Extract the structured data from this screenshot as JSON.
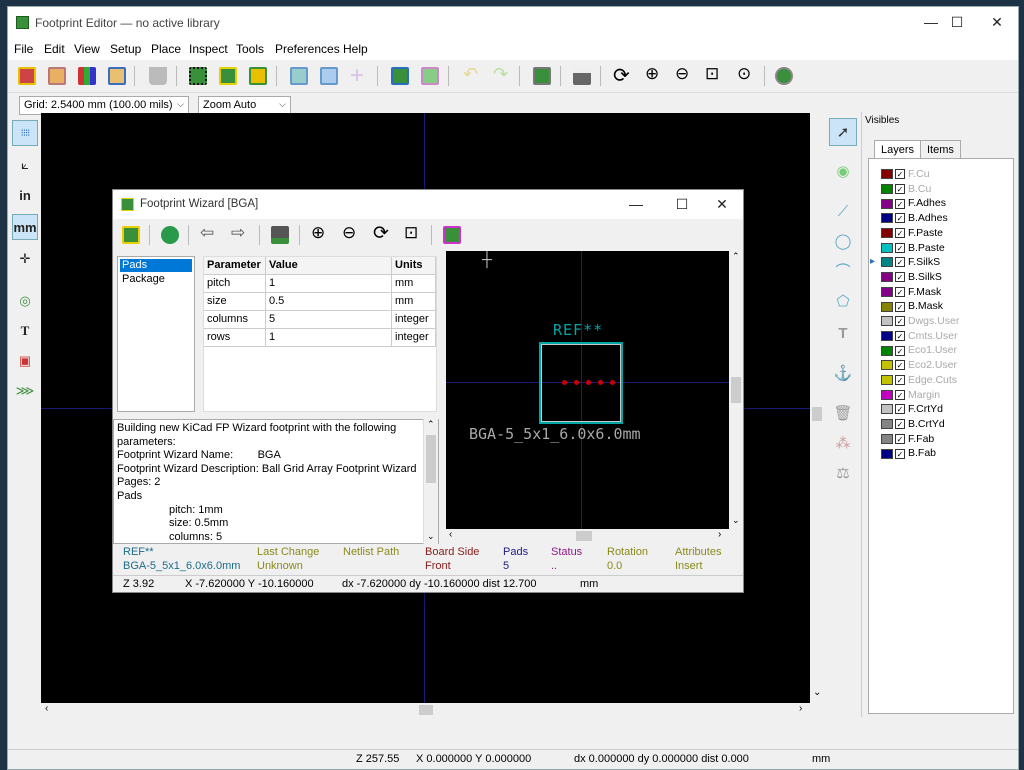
{
  "window": {
    "title": "Footprint Editor — no active library",
    "minimize": "—",
    "maximize": "☐",
    "close": "✕"
  },
  "menu": [
    "File",
    "Edit",
    "View",
    "Setup",
    "Place",
    "Inspect",
    "Tools",
    "Preferences",
    "Help"
  ],
  "options": {
    "grid": "Grid: 2.5400 mm (100.00 mils)",
    "zoom": "Zoom Auto"
  },
  "left_toolbar": {
    "units_in": "in",
    "units_mm": "mm"
  },
  "panel": {
    "title": "Visibles",
    "tabs": [
      "Layers",
      "Items"
    ],
    "layers": [
      {
        "name": "F.Cu",
        "color": "#840000",
        "dim": true
      },
      {
        "name": "B.Cu",
        "color": "#008400",
        "dim": true
      },
      {
        "name": "F.Adhes",
        "color": "#840084",
        "dim": false
      },
      {
        "name": "B.Adhes",
        "color": "#000084",
        "dim": false
      },
      {
        "name": "F.Paste",
        "color": "#840000",
        "dim": false
      },
      {
        "name": "B.Paste",
        "color": "#00c2c2",
        "dim": false
      },
      {
        "name": "F.SilkS",
        "color": "#008484",
        "dim": false
      },
      {
        "name": "B.SilkS",
        "color": "#840084",
        "dim": false
      },
      {
        "name": "F.Mask",
        "color": "#840084",
        "dim": false
      },
      {
        "name": "B.Mask",
        "color": "#848400",
        "dim": false
      },
      {
        "name": "Dwgs.User",
        "color": "#c2c2c2",
        "dim": true
      },
      {
        "name": "Cmts.User",
        "color": "#000084",
        "dim": true
      },
      {
        "name": "Eco1.User",
        "color": "#008400",
        "dim": true
      },
      {
        "name": "Eco2.User",
        "color": "#c2c200",
        "dim": true
      },
      {
        "name": "Edge.Cuts",
        "color": "#c2c200",
        "dim": true
      },
      {
        "name": "Margin",
        "color": "#c200c2",
        "dim": true
      },
      {
        "name": "F.CrtYd",
        "color": "#c2c2c2",
        "dim": false
      },
      {
        "name": "B.CrtYd",
        "color": "#848484",
        "dim": false
      },
      {
        "name": "F.Fab",
        "color": "#848484",
        "dim": false
      },
      {
        "name": "B.Fab",
        "color": "#000084",
        "dim": false
      }
    ]
  },
  "status": {
    "z": "Z 257.55",
    "xy": "X 0.000000  Y 0.000000",
    "dxy": "dx 0.000000  dy 0.000000  dist 0.000",
    "units": "mm"
  },
  "dialog": {
    "title": "Footprint Wizard [BGA]",
    "pages": [
      "Pads",
      "Package"
    ],
    "table_headers": [
      "Parameter",
      "Value",
      "Units"
    ],
    "rows": [
      [
        "pitch",
        "1",
        "mm"
      ],
      [
        "size",
        "0.5",
        "mm"
      ],
      [
        "columns",
        "5",
        "integer"
      ],
      [
        "rows",
        "1",
        "integer"
      ]
    ],
    "messages": [
      "Building new KiCad FP Wizard footprint with the following",
      "parameters:",
      "Footprint Wizard Name:        BGA",
      "Footprint Wizard Description: Ball Grid Array Footprint Wizard",
      "Pages: 2",
      "Pads",
      "                 pitch: 1mm",
      "                 size: 0.5mm",
      "                 columns: 5"
    ],
    "preview": {
      "ref": "REF**",
      "value": "BGA-5_5x1_6.0x6.0mm"
    },
    "msgpanel": [
      {
        "label": "REF**",
        "value": "BGA-5_5x1_6.0x6.0mm",
        "color": "#1b6c8a"
      },
      {
        "label": "Last Change",
        "value": "Unknown",
        "color": "#8a8a1b"
      },
      {
        "label": "Netlist Path",
        "value": "",
        "color": "#8a8a1b"
      },
      {
        "label": "Board Side",
        "value": "Front",
        "color": "#8a1b1b"
      },
      {
        "label": "Pads",
        "value": "5",
        "color": "#1b1b8a"
      },
      {
        "label": "Status",
        "value": "..",
        "color": "#8a1b8a"
      },
      {
        "label": "Rotation",
        "value": "0.0",
        "color": "#8a8a1b"
      },
      {
        "label": "Attributes",
        "value": "Insert",
        "color": "#8a8a1b"
      }
    ],
    "status": {
      "z": "Z 3.92",
      "xy": "X -7.620000  Y -10.160000",
      "dxy": "dx -7.620000  dy -10.160000  dist 12.700",
      "units": "mm"
    }
  }
}
